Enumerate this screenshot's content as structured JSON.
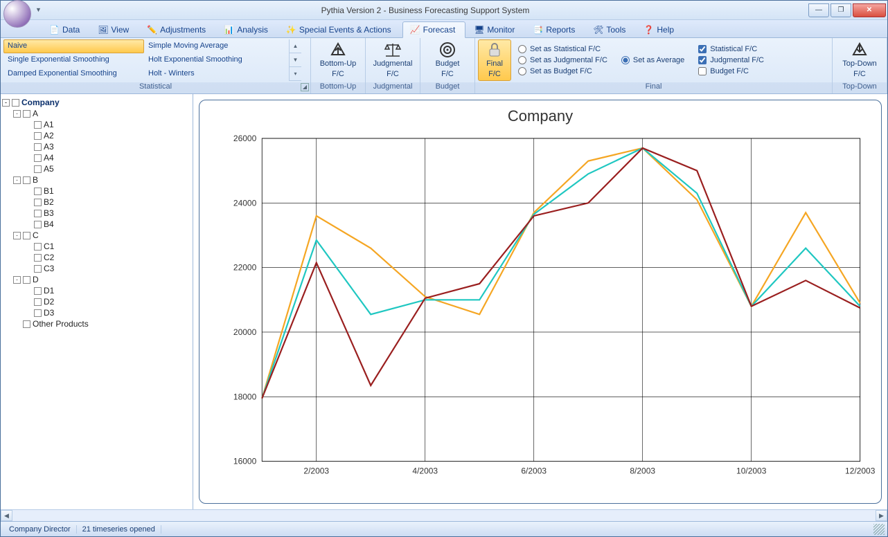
{
  "window": {
    "title": "Pythia Version 2 - Business Forecasting Support System",
    "min_icon": "—",
    "max_icon": "❐",
    "close_icon": "✕"
  },
  "tabs": {
    "data": "Data",
    "view": "View",
    "adjustments": "Adjustments",
    "analysis": "Analysis",
    "special": "Special Events & Actions",
    "forecast": "Forecast",
    "monitor": "Monitor",
    "reports": "Reports",
    "tools": "Tools",
    "help": "Help"
  },
  "ribbon": {
    "statistical": {
      "label": "Statistical",
      "items": [
        "Naive",
        "Simple Moving Average",
        "Single Exponential Smoothing",
        "Holt Exponential Smoothing",
        "Damped Exponential Smoothing",
        "Holt - Winters"
      ]
    },
    "bottomup": {
      "line1": "Bottom-Up",
      "line2": "F/C",
      "label": "Bottom-Up"
    },
    "judgmental": {
      "line1": "Judgmental",
      "line2": "F/C",
      "label": "Judgmental"
    },
    "budget": {
      "line1": "Budget",
      "line2": "F/C",
      "label": "Budget"
    },
    "final_btn": {
      "line1": "Final",
      "line2": "F/C"
    },
    "final": {
      "label": "Final",
      "set_stat": "Set as Statistical F/C",
      "set_judg": "Set as Judgmental F/C",
      "set_budget": "Set as Budget F/C",
      "set_avg": "Set as Average",
      "chk_stat": "Statistical F/C",
      "chk_judg": "Judgmental F/C",
      "chk_budget": "Budget F/C"
    },
    "topdown": {
      "line1": "Top-Down",
      "line2": "F/C",
      "label": "Top-Down"
    }
  },
  "tree": {
    "root": "Company",
    "nodes": [
      {
        "label": "A",
        "children": [
          "A1",
          "A2",
          "A3",
          "A4",
          "A5"
        ]
      },
      {
        "label": "B",
        "children": [
          "B1",
          "B2",
          "B3",
          "B4"
        ]
      },
      {
        "label": "C",
        "children": [
          "C1",
          "C2",
          "C3"
        ]
      },
      {
        "label": "D",
        "children": [
          "D1",
          "D2",
          "D3"
        ]
      }
    ],
    "other": "Other Products"
  },
  "status": {
    "user": "Company Director",
    "count": "21 timeseries opened"
  },
  "chart_data": {
    "type": "line",
    "title": "Company",
    "xlabel": "",
    "ylabel": "",
    "ylim": [
      16000,
      26000
    ],
    "yticks": [
      16000,
      18000,
      20000,
      22000,
      24000,
      26000
    ],
    "categories": [
      "1/2003",
      "2/2003",
      "3/2003",
      "4/2003",
      "5/2003",
      "6/2003",
      "7/2003",
      "8/2003",
      "9/2003",
      "10/2003",
      "11/2003",
      "12/2003"
    ],
    "xticks": [
      "2/2003",
      "4/2003",
      "6/2003",
      "8/2003",
      "10/2003",
      "12/2003"
    ],
    "series": [
      {
        "name": "Statistical",
        "color": "#f5a623",
        "values": [
          17950,
          23600,
          22600,
          21100,
          20550,
          23700,
          25300,
          25700,
          24100,
          20800,
          23700,
          20900
        ]
      },
      {
        "name": "Judgmental",
        "color": "#1fc7c1",
        "values": [
          17950,
          22850,
          20550,
          21000,
          21000,
          23650,
          24900,
          25700,
          24300,
          20800,
          22600,
          20800
        ]
      },
      {
        "name": "Final",
        "color": "#9a1f1f",
        "values": [
          17950,
          22150,
          18350,
          21050,
          21500,
          23600,
          24000,
          25700,
          25000,
          20800,
          21600,
          20750
        ]
      }
    ]
  }
}
